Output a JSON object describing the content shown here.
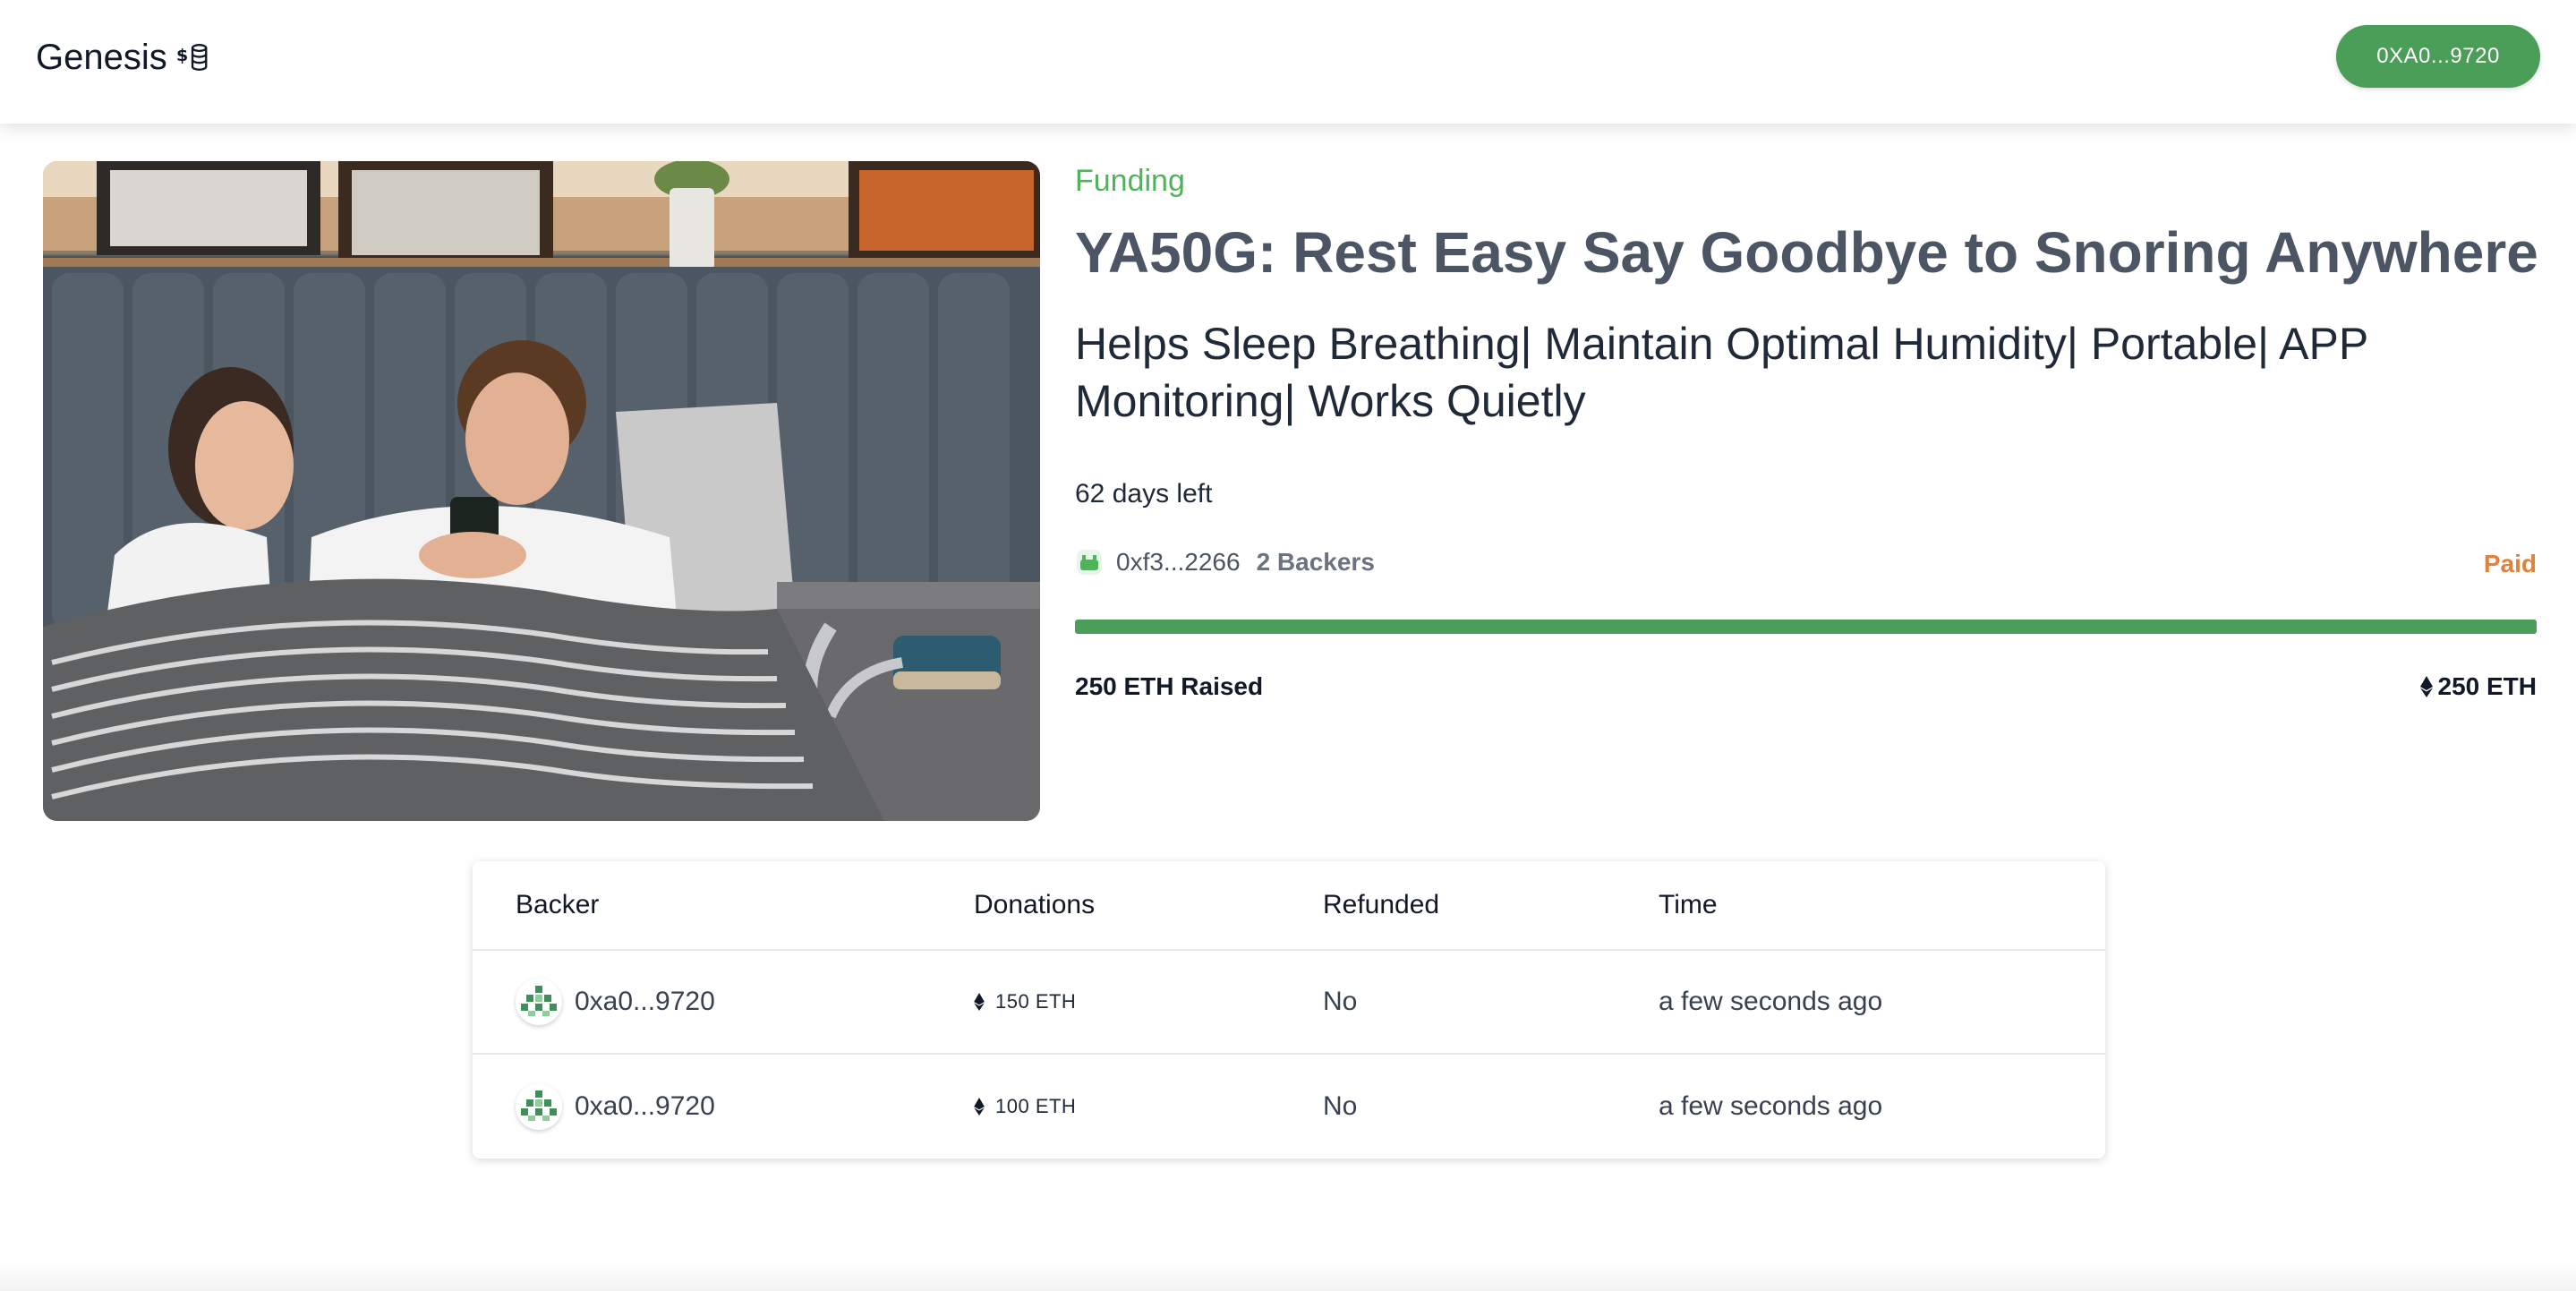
{
  "header": {
    "app_name": "Genesis",
    "logo_icon": "coins-dollar-icon",
    "wallet_button": "0XA0...9720"
  },
  "project": {
    "image_alt": "couple in bed with portable anti-snoring device",
    "status": "Funding",
    "title": "YA50G: Rest Easy Say Goodbye to Snoring Anywhere",
    "description": "Helps Sleep Breathing| Maintain Optimal Humidity| Portable| APP Monitoring| Works Quietly",
    "days_left": "62 days left",
    "owner_address": "0xf3...2266",
    "backers": "2 Backers",
    "payout_status": "Paid",
    "progress_fraction": 1.0,
    "raised": "250 ETH Raised",
    "goal": "250 ETH"
  },
  "table": {
    "headers": {
      "backer": "Backer",
      "donations": "Donations",
      "refunded": "Refunded",
      "time": "Time"
    },
    "rows": [
      {
        "backer": "0xa0...9720",
        "donation": "150 ETH",
        "refunded": "No",
        "time": "a few seconds ago"
      },
      {
        "backer": "0xa0...9720",
        "donation": "100 ETH",
        "refunded": "No",
        "time": "a few seconds ago"
      }
    ]
  },
  "colors": {
    "accent_green": "#4a9e57",
    "status_green": "#4fb35a",
    "paid_orange": "#e0823c"
  }
}
